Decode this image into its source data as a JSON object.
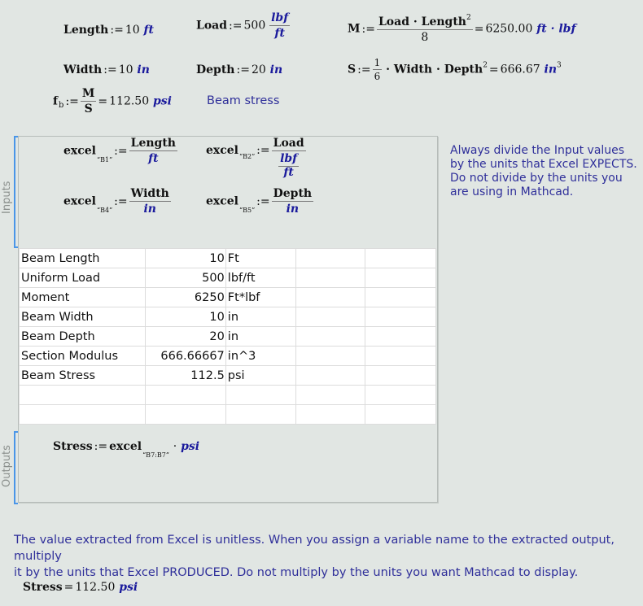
{
  "definitions": {
    "length": {
      "var": "Length",
      "op": ":=",
      "value": "10",
      "unit": "ft"
    },
    "load": {
      "var": "Load",
      "op": ":=",
      "value": "500",
      "unit_num": "lbf",
      "unit_den": "ft"
    },
    "moment": {
      "var": "M",
      "op": ":=",
      "numerator": "Load · Length",
      "num_exp": "2",
      "denominator": "8",
      "eq": "=",
      "result": "6250.00",
      "unit": "ft · lbf"
    },
    "width": {
      "var": "Width",
      "op": ":=",
      "value": "10",
      "unit": "in"
    },
    "depth": {
      "var": "Depth",
      "op": ":=",
      "value": "20",
      "unit": "in"
    },
    "section": {
      "var": "S",
      "op": ":=",
      "frac_num": "1",
      "frac_den": "6",
      "expr": "· Width · Depth",
      "expr_exp": "2",
      "eq": "=",
      "result": "666.67",
      "unit": "in",
      "unit_exp": "3"
    },
    "stress": {
      "var": "f",
      "var_sub": "b",
      "op": ":=",
      "numerator": "M",
      "denominator": "S",
      "eq": "=",
      "result": "112.50",
      "unit": "psi"
    },
    "stress_note": "Beam stress"
  },
  "inputs_area": {
    "label": "Inputs",
    "assignments": [
      {
        "func": "excel",
        "cell": "“B1”",
        "op": ":=",
        "numerator": "Length",
        "denominator": "ft"
      },
      {
        "func": "excel",
        "cell": "“B2”",
        "op": ":=",
        "numerator": "Load",
        "den_num": "lbf",
        "den_den": "ft"
      },
      {
        "func": "excel",
        "cell": "“B4”",
        "op": ":=",
        "numerator": "Width",
        "denominator": "in"
      },
      {
        "func": "excel",
        "cell": "“B5”",
        "op": ":=",
        "numerator": "Depth",
        "denominator": "in"
      }
    ],
    "note": [
      "Always divide the Input values",
      "by the units that Excel EXPECTS.",
      "Do not divide by the units you",
      "are using in Mathcad."
    ]
  },
  "spreadsheet": {
    "rows": [
      {
        "label": "Beam Length",
        "value": "10",
        "unit": "Ft"
      },
      {
        "label": "Uniform Load",
        "value": "500",
        "unit": "lbf/ft"
      },
      {
        "label": "Moment",
        "value": "6250",
        "unit": "Ft*lbf"
      },
      {
        "label": "Beam Width",
        "value": "10",
        "unit": "in"
      },
      {
        "label": "Beam Depth",
        "value": "20",
        "unit": "in"
      },
      {
        "label": "Section Modulus",
        "value": "666.66667",
        "unit": "in^3"
      },
      {
        "label": "Beam Stress",
        "value": "112.5",
        "unit": "psi"
      },
      {
        "label": "",
        "value": "",
        "unit": ""
      },
      {
        "label": "",
        "value": "",
        "unit": ""
      }
    ]
  },
  "outputs_area": {
    "label": "Outputs",
    "assignment": {
      "var": "Stress",
      "op": ":=",
      "func": "excel",
      "range": "“B7:B7”",
      "mult": "·",
      "unit": "psi"
    }
  },
  "output_note": [
    "The value extracted from Excel is unitless. When you assign a variable name to the extracted output, multiply",
    "it by the units that Excel PRODUCED. Do not multiply by the units you want Mathcad to display."
  ],
  "result": {
    "var": "Stress",
    "eq": "=",
    "value": "112.50",
    "unit": "psi"
  }
}
